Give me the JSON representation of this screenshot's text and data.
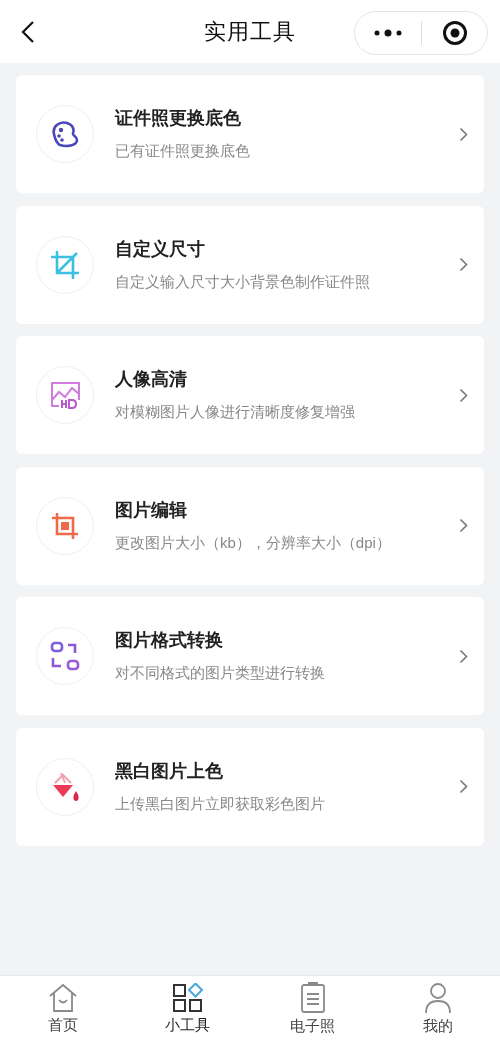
{
  "header": {
    "title": "实用工具"
  },
  "tools": [
    {
      "kind": "palette",
      "title": "证件照更换底色",
      "subtitle": "已有证件照更换底色"
    },
    {
      "kind": "crop",
      "title": "自定义尺寸",
      "subtitle": "自定义输入尺寸大小背景色制作证件照"
    },
    {
      "kind": "hd",
      "title": "人像高清",
      "subtitle": "对模糊图片人像进行清晰度修复增强"
    },
    {
      "kind": "edit",
      "title": "图片编辑",
      "subtitle": "更改图片大小（kb），分辨率大小（dpi）"
    },
    {
      "kind": "convert",
      "title": "图片格式转换",
      "subtitle": "对不同格式的图片类型进行转换"
    },
    {
      "kind": "bucket",
      "title": "黑白图片上色",
      "subtitle": "上传黑白图片立即获取彩色图片"
    }
  ],
  "tab_bar": [
    {
      "kind": "home",
      "label": "首页",
      "selected": false
    },
    {
      "kind": "tools",
      "label": "小工具",
      "selected": true
    },
    {
      "kind": "doc",
      "label": "电子照",
      "selected": false
    },
    {
      "kind": "me",
      "label": "我的",
      "selected": false
    }
  ]
}
